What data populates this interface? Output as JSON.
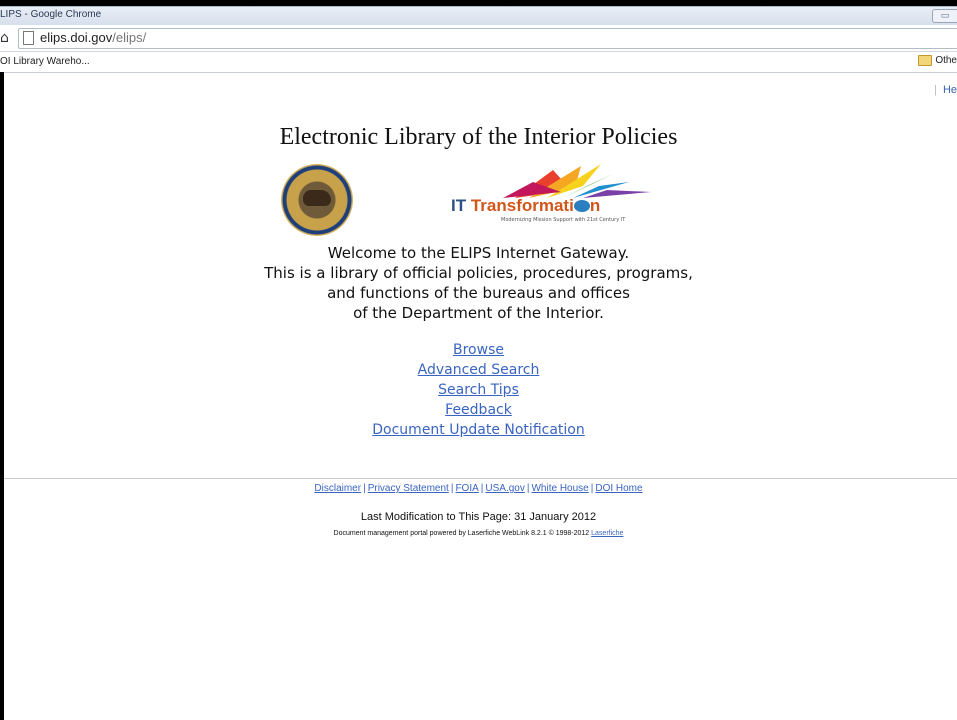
{
  "browser": {
    "window_title": "LIPS - Google Chrome",
    "window_button": "▭",
    "url_host": "elips.doi.gov",
    "url_path": "/elips/",
    "bookmark": "OI Library Wareho...",
    "other_bookmarks": "Othe"
  },
  "header": {
    "help_sep": "|",
    "help_label": "He",
    "title": "Electronic Library of the Interior Policies"
  },
  "logos": {
    "it_prefix": "IT",
    "it_text": "Transformati",
    "it_end": "n",
    "it_tagline": "Modernizing Mission Support with 21st Century IT"
  },
  "welcome": {
    "line1": "Welcome to the ELIPS Internet Gateway.",
    "line2": "This is a library of official policies, procedures, programs,",
    "line3": "and functions of the bureaus and offices",
    "line4": "of the Department of the Interior."
  },
  "nav": {
    "browse": "Browse",
    "advanced_search": "Advanced Search",
    "search_tips": "Search Tips",
    "feedback": "Feedback",
    "update_notification": "Document Update Notification"
  },
  "footer": {
    "links": [
      "Disclaimer",
      "Privacy Statement",
      "FOIA",
      "USA.gov",
      "White House",
      "DOI Home"
    ],
    "separator": "|",
    "last_modification": "Last Modification to This Page: 31 January 2012",
    "powered_by": "Document management portal powered by Laserfiche WebLink 8.2.1 © 1998-2012",
    "laserfiche": "Laserfiche"
  },
  "colors": {
    "link": "#3a64c2",
    "it_orange": "#d2561a",
    "it_blue": "#2b4f86"
  }
}
